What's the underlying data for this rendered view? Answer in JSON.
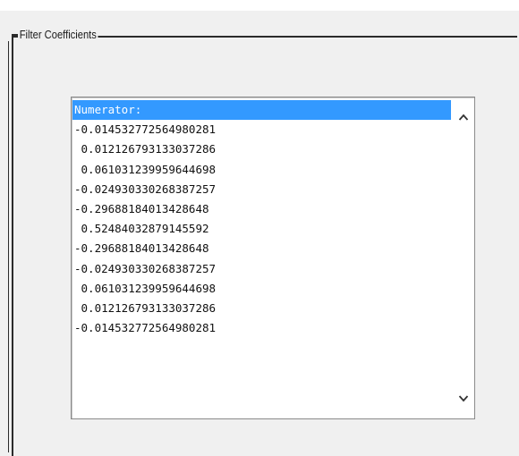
{
  "groupbox": {
    "title": "Filter Coefficients"
  },
  "listbox": {
    "items": [
      "Numerator:",
      "-0.014532772564980281",
      " 0.012126793133037286",
      " 0.061031239959644698",
      "-0.024930330268387257",
      "-0.29688184013428648",
      " 0.52484032879145592",
      "-0.29688184013428648",
      "-0.024930330268387257",
      " 0.061031239959644698",
      " 0.012126793133037286",
      "-0.014532772564980281"
    ],
    "selected_index": 0
  },
  "scrollbar": {
    "up_icon": "chevron-up-icon",
    "down_icon": "chevron-down-icon"
  },
  "colors": {
    "selection": "#3399ff",
    "list_background": "#ffffff",
    "window_background": "#f0f0f0"
  }
}
